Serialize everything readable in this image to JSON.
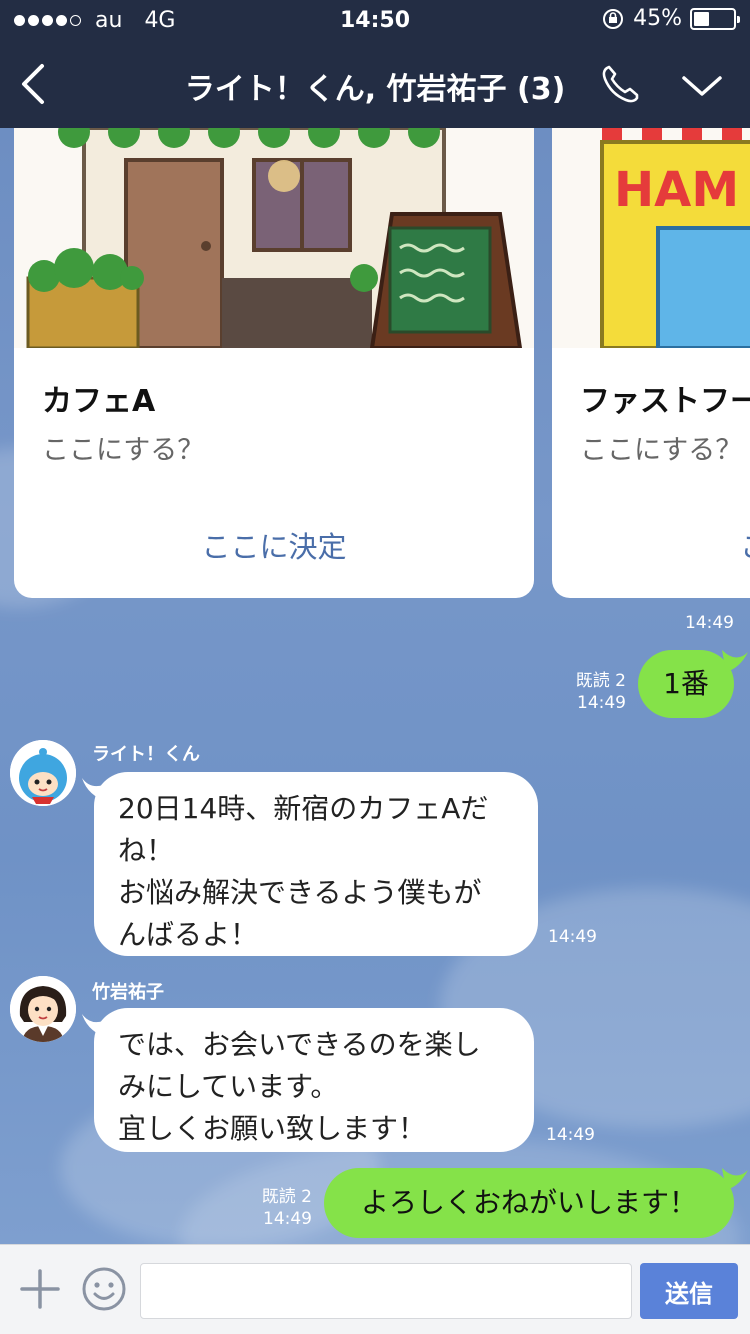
{
  "status_bar": {
    "carrier": "au",
    "network": "4G",
    "time": "14:50",
    "battery": "45%",
    "battery_level": 0.45
  },
  "header": {
    "title": "ライト！くん, 竹岩祐子 (3)"
  },
  "carousel": {
    "cards": [
      {
        "title": "カフェA",
        "text": "ここにする？",
        "action": "ここに決定"
      },
      {
        "title": "ファストフー",
        "text": "ここにする？",
        "action": "こ",
        "image_text": "HAM"
      }
    ],
    "time": "14:49"
  },
  "messages": [
    {
      "read": "既読 2",
      "time": "14:49",
      "text": "1番"
    },
    {
      "sender": "ライト！くん",
      "lines": [
        "20日14時、新宿のカフェAだ",
        "ね！",
        "お悩み解決できるよう僕もが",
        "んばるよ！"
      ],
      "time": "14:49"
    },
    {
      "sender": "竹岩祐子",
      "lines": [
        "では、お会いできるのを楽し",
        "みにしています。",
        "宜しくお願い致します！"
      ],
      "time": "14:49"
    },
    {
      "read": "既読 2",
      "time": "14:49",
      "text": "よろしくおねがいします！"
    }
  ],
  "composer": {
    "placeholder": "",
    "send_label": "送信"
  },
  "colors": {
    "header": "#232d44",
    "bubble_out": "#85e249",
    "link": "#4a6ea9",
    "send": "#5a82d9"
  },
  "icons": [
    "back-icon",
    "phone-icon",
    "chevron-down-icon",
    "plus-icon",
    "emoji-icon",
    "rotation-lock-icon"
  ]
}
